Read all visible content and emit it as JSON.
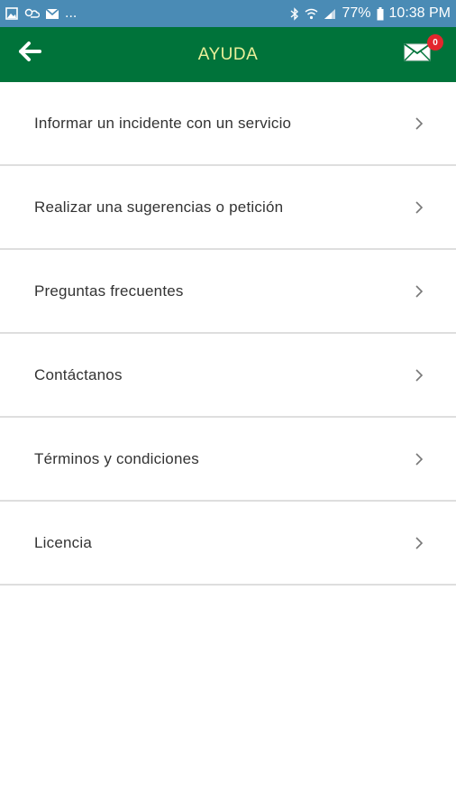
{
  "status_bar": {
    "left_icons": [
      "image-icon",
      "weather-icon",
      "gmail-icon"
    ],
    "overflow": "...",
    "battery": "77%",
    "time": "10:38 PM"
  },
  "header": {
    "title": "AYUDA",
    "mail_badge_count": "0"
  },
  "menu": {
    "items": [
      {
        "label": "Informar un incidente con un servicio"
      },
      {
        "label": "Realizar una sugerencias o petición"
      },
      {
        "label": "Preguntas frecuentes"
      },
      {
        "label": "Contáctanos"
      },
      {
        "label": "Términos y condiciones"
      },
      {
        "label": "Licencia"
      }
    ]
  },
  "colors": {
    "status_bar": "#4a8bb5",
    "header": "#00733a",
    "title": "#e9ef9a",
    "badge": "#e3262d",
    "divider": "#dedede",
    "label_text": "#333333"
  }
}
